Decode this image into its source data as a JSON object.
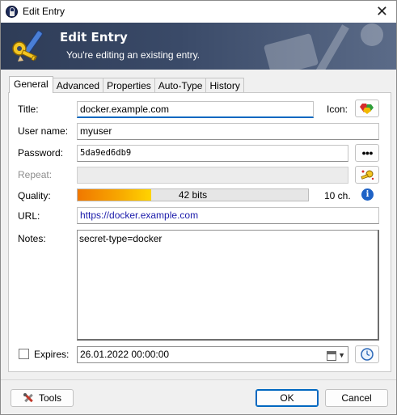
{
  "window": {
    "title": "Edit Entry",
    "close_glyph": "✕"
  },
  "banner": {
    "title": "Edit Entry",
    "subtitle": "You're editing an existing entry."
  },
  "tabs": [
    {
      "label": "General",
      "active": true
    },
    {
      "label": "Advanced"
    },
    {
      "label": "Properties"
    },
    {
      "label": "Auto-Type"
    },
    {
      "label": "History"
    }
  ],
  "form": {
    "title_label": "Title:",
    "title_value": "docker.example.com",
    "icon_label": "Icon:",
    "username_label": "User name:",
    "username_value": "myuser",
    "password_label": "Password:",
    "password_value": "5da9ed6db9",
    "repeat_label": "Repeat:",
    "repeat_value": "",
    "quality_label": "Quality:",
    "quality_text": "42 bits",
    "quality_fraction": 0.32,
    "quality_chars": "10 ch.",
    "url_label": "URL:",
    "url_value": "https://docker.example.com",
    "notes_label": "Notes:",
    "notes_value": "secret-type=docker",
    "expires_label": "Expires:",
    "expires_checked": false,
    "expires_value": "26.01.2022 00:00:00"
  },
  "buttons": {
    "tools": "Tools",
    "ok": "OK",
    "cancel": "Cancel",
    "show_password_glyph": "●●●"
  },
  "icons": {
    "app": "keepass-lock-icon",
    "banner": "key-pen-icon",
    "entry_icon": "colorful-gems-icon",
    "password_generator": "password-generator-icon",
    "info": "info-icon",
    "calendar": "calendar-icon",
    "expiry_clock": "clock-icon",
    "tools": "wrench-icon"
  },
  "colors": {
    "banner_start": "#2e3c57",
    "banner_end": "#5b6b88",
    "quality_start": "#f07800",
    "quality_end": "#ffd400",
    "accent": "#0067c0"
  }
}
